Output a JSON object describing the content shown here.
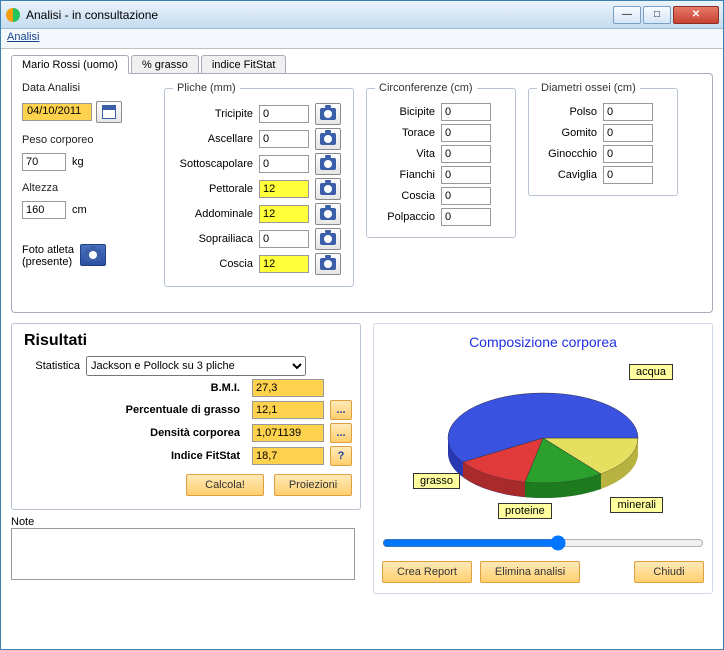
{
  "window": {
    "title": "Analisi - in consultazione"
  },
  "menu": {
    "analisi": "Analisi"
  },
  "tabs": [
    {
      "label": "Mario Rossi (uomo)"
    },
    {
      "label": "% grasso"
    },
    {
      "label": "indice FitStat"
    }
  ],
  "left": {
    "data_label": "Data Analisi",
    "data_value": "04/10/2011",
    "peso_label": "Peso corporeo",
    "peso_value": "70",
    "peso_unit": "kg",
    "alt_label": "Altezza",
    "alt_value": "160",
    "alt_unit": "cm",
    "foto_label1": "Foto atleta",
    "foto_label2": "(presente)"
  },
  "pliche": {
    "legend": "Pliche (mm)",
    "rows": [
      {
        "label": "Tricipite",
        "value": "0",
        "hl": false
      },
      {
        "label": "Ascellare",
        "value": "0",
        "hl": false
      },
      {
        "label": "Sottoscapolare",
        "value": "0",
        "hl": false
      },
      {
        "label": "Pettorale",
        "value": "12",
        "hl": true
      },
      {
        "label": "Addominale",
        "value": "12",
        "hl": true
      },
      {
        "label": "Soprailiaca",
        "value": "0",
        "hl": false
      },
      {
        "label": "Coscia",
        "value": "12",
        "hl": true
      }
    ]
  },
  "circ": {
    "legend": "Circonferenze (cm)",
    "rows": [
      {
        "label": "Bicipite",
        "value": "0"
      },
      {
        "label": "Torace",
        "value": "0"
      },
      {
        "label": "Vita",
        "value": "0"
      },
      {
        "label": "Fianchi",
        "value": "0"
      },
      {
        "label": "Coscia",
        "value": "0"
      },
      {
        "label": "Polpaccio",
        "value": "0"
      }
    ]
  },
  "diam": {
    "legend": "Diametri ossei (cm)",
    "rows": [
      {
        "label": "Polso",
        "value": "0"
      },
      {
        "label": "Gomito",
        "value": "0"
      },
      {
        "label": "Ginocchio",
        "value": "0"
      },
      {
        "label": "Caviglia",
        "value": "0"
      }
    ]
  },
  "results": {
    "header": "Risultati",
    "stat_label": "Statistica",
    "stat_value": "Jackson e Pollock su 3 pliche",
    "rows": [
      {
        "label": "B.M.I.",
        "value": "27,3",
        "btn": null
      },
      {
        "label": "Percentuale di grasso",
        "value": "12,1",
        "btn": "..."
      },
      {
        "label": "Densità corporea",
        "value": "1,071139",
        "btn": "..."
      },
      {
        "label": "Indice FitStat",
        "value": "18,7",
        "btn": "?"
      }
    ],
    "calcola": "Calcola!",
    "proiezioni": "Proiezioni",
    "note_label": "Note",
    "note_value": ""
  },
  "chart": {
    "title": "Composizione corporea",
    "labels": {
      "acqua": "acqua",
      "minerali": "minerali",
      "proteine": "proteine",
      "grasso": "grasso"
    }
  },
  "chart_data": {
    "type": "pie",
    "title": "Composizione corporea",
    "categories": [
      "acqua",
      "grasso",
      "proteine",
      "minerali"
    ],
    "values": [
      62,
      12,
      18,
      8
    ],
    "colors": {
      "acqua": "#3a52e0",
      "grasso": "#e03a3a",
      "proteine": "#2ca02c",
      "minerali": "#e6e060"
    }
  },
  "buttons": {
    "crea_report": "Crea Report",
    "elimina": "Elimina analisi",
    "chiudi": "Chiudi"
  }
}
